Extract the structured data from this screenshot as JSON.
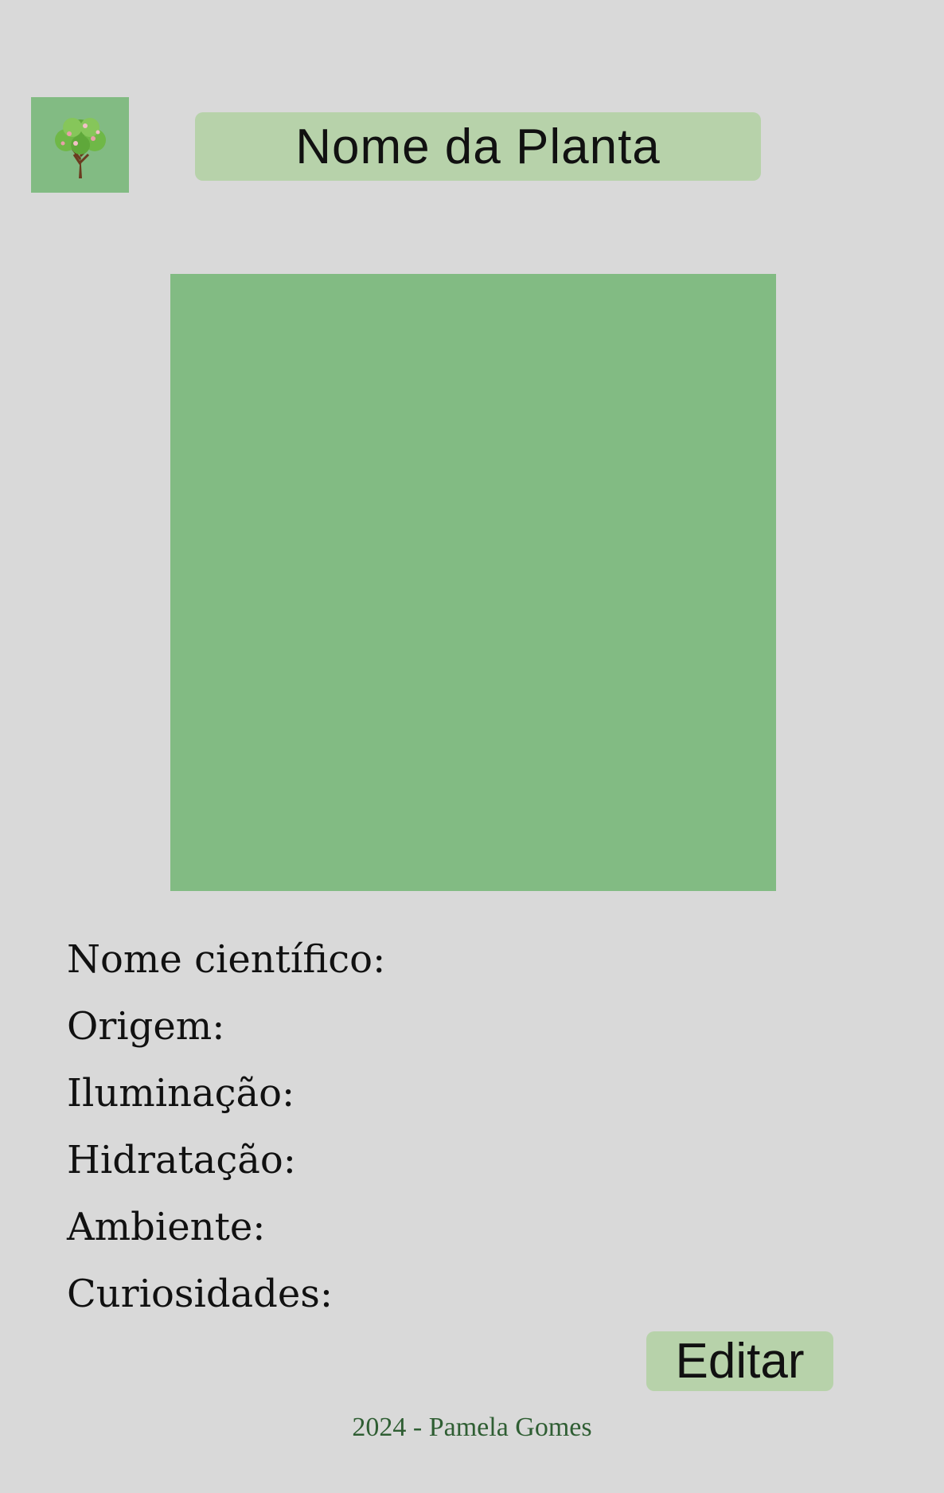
{
  "header": {
    "logo_icon": "tree-icon",
    "title": "Nome da Planta"
  },
  "photo": {
    "placeholder_color": "#82bb83"
  },
  "details": {
    "fields": [
      {
        "label": "Nome científico:"
      },
      {
        "label": "Origem:"
      },
      {
        "label": "Iluminação:"
      },
      {
        "label": "Hidratação:"
      },
      {
        "label": "Ambiente:"
      },
      {
        "label": "Curiosidades:"
      }
    ]
  },
  "actions": {
    "edit_label": "Editar"
  },
  "footer": {
    "text": "2024 - Pamela Gomes"
  },
  "colors": {
    "background": "#d9d9d9",
    "accent_green": "#82bb83",
    "light_green": "#b7d2aa",
    "footer_text": "#2f5e33"
  }
}
